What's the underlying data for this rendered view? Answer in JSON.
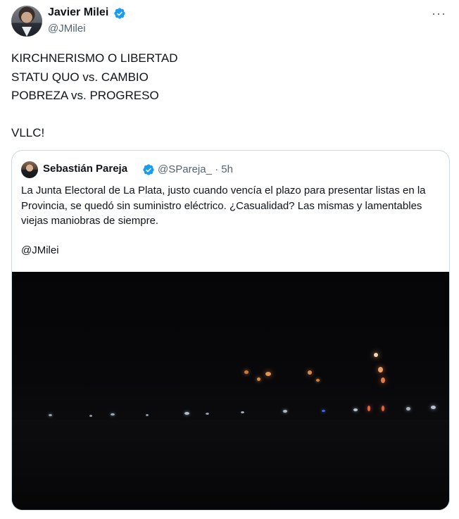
{
  "author": {
    "name": "Javier Milei",
    "handle": "@JMilei",
    "more_label": "···"
  },
  "tweet": {
    "lines": [
      "KIRCHNERISMO O LIBERTAD",
      "STATU QUO vs. CAMBIO",
      "POBREZA vs. PROGRESO",
      "VLLC!"
    ]
  },
  "quote": {
    "name": "Sebastián Pareja",
    "handle": "@SPareja_",
    "separator": "·",
    "time": "5h",
    "text": "La Junta Electoral de La Plata, justo cuando vencía el plazo para presentar listas en la Provincia, se quedó sin suministro eléctrico. ¿Casualidad? Las mismas y lamentables viejas maniobras de siempre.",
    "mention": "@JMilei"
  },
  "colors": {
    "verified": "#1d9bf0",
    "secondary_text": "#536471",
    "border": "#cfd9de"
  },
  "icons": {
    "verified": "verified-badge-icon",
    "more": "more-dots-icon"
  }
}
